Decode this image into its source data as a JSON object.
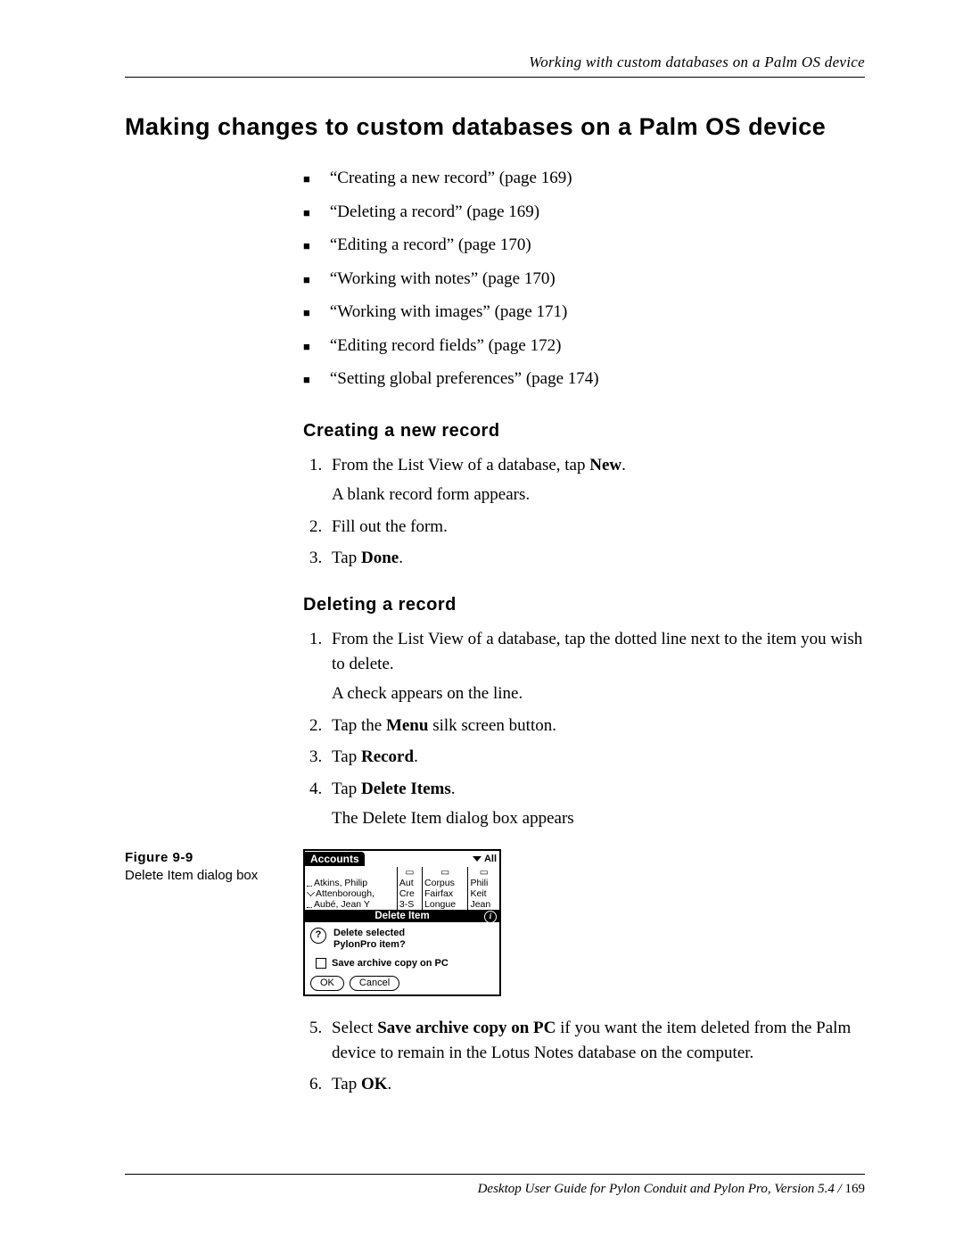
{
  "running_head": "Working with custom databases on a Palm OS device",
  "section_title": "Making changes to custom databases on a Palm OS device",
  "toc": [
    "“Creating a new record” (page 169)",
    "“Deleting a record” (page 169)",
    "“Editing a record” (page 170)",
    "“Working with notes” (page 170)",
    "“Working with images” (page 171)",
    "“Editing record fields” (page 172)",
    "“Setting global preferences” (page 174)"
  ],
  "creating": {
    "heading": "Creating a new record",
    "step1a": "From the List View of a database, tap ",
    "step1b": "New",
    "step1c": ".",
    "step1_after": "A blank record form appears.",
    "step2": "Fill out the form.",
    "step3a": "Tap ",
    "step3b": "Done",
    "step3c": "."
  },
  "deleting": {
    "heading": "Deleting a record",
    "step1": "From the List View of a database, tap the dotted line next to the item you wish to delete.",
    "step1_after": "A check appears on the line.",
    "step2a": "Tap the ",
    "step2b": "Menu",
    "step2c": " silk screen button.",
    "step3a": "Tap ",
    "step3b": "Record",
    "step3c": ".",
    "step4a": "Tap ",
    "step4b": "Delete Items",
    "step4c": ".",
    "step4_after": "The Delete Item dialog box appears",
    "step5a": "Select ",
    "step5b": "Save archive copy on PC",
    "step5c": " if you want the item deleted from the Palm device to remain in the Lotus Notes database on the computer.",
    "step6a": "Tap ",
    "step6b": "OK",
    "step6c": "."
  },
  "figure": {
    "number": "Figure 9-9",
    "caption": "Delete Item dialog box"
  },
  "palm": {
    "tab": "Accounts",
    "category": "All",
    "rows": [
      {
        "c0": "Atkins, Philip",
        "c1": "Aut",
        "c2": "Corpus",
        "c3": "Phili",
        "checked": false
      },
      {
        "c0": "Attenborough,",
        "c1": "Cre",
        "c2": "Fairfax",
        "c3": "Keit",
        "checked": true
      },
      {
        "c0": "Aubé, Jean Y",
        "c1": "3-S",
        "c2": "Longue",
        "c3": "Jean",
        "checked": false
      }
    ],
    "dialog_title": "Delete Item",
    "msg1": "Delete selected",
    "msg2": "PylonPro item?",
    "archive": "Save archive copy on PC",
    "ok": "OK",
    "cancel": "Cancel"
  },
  "footer": {
    "text": "Desktop User Guide for Pylon Conduit and Pylon Pro, Version 5.4",
    "sep": "  /  ",
    "page": "169"
  }
}
